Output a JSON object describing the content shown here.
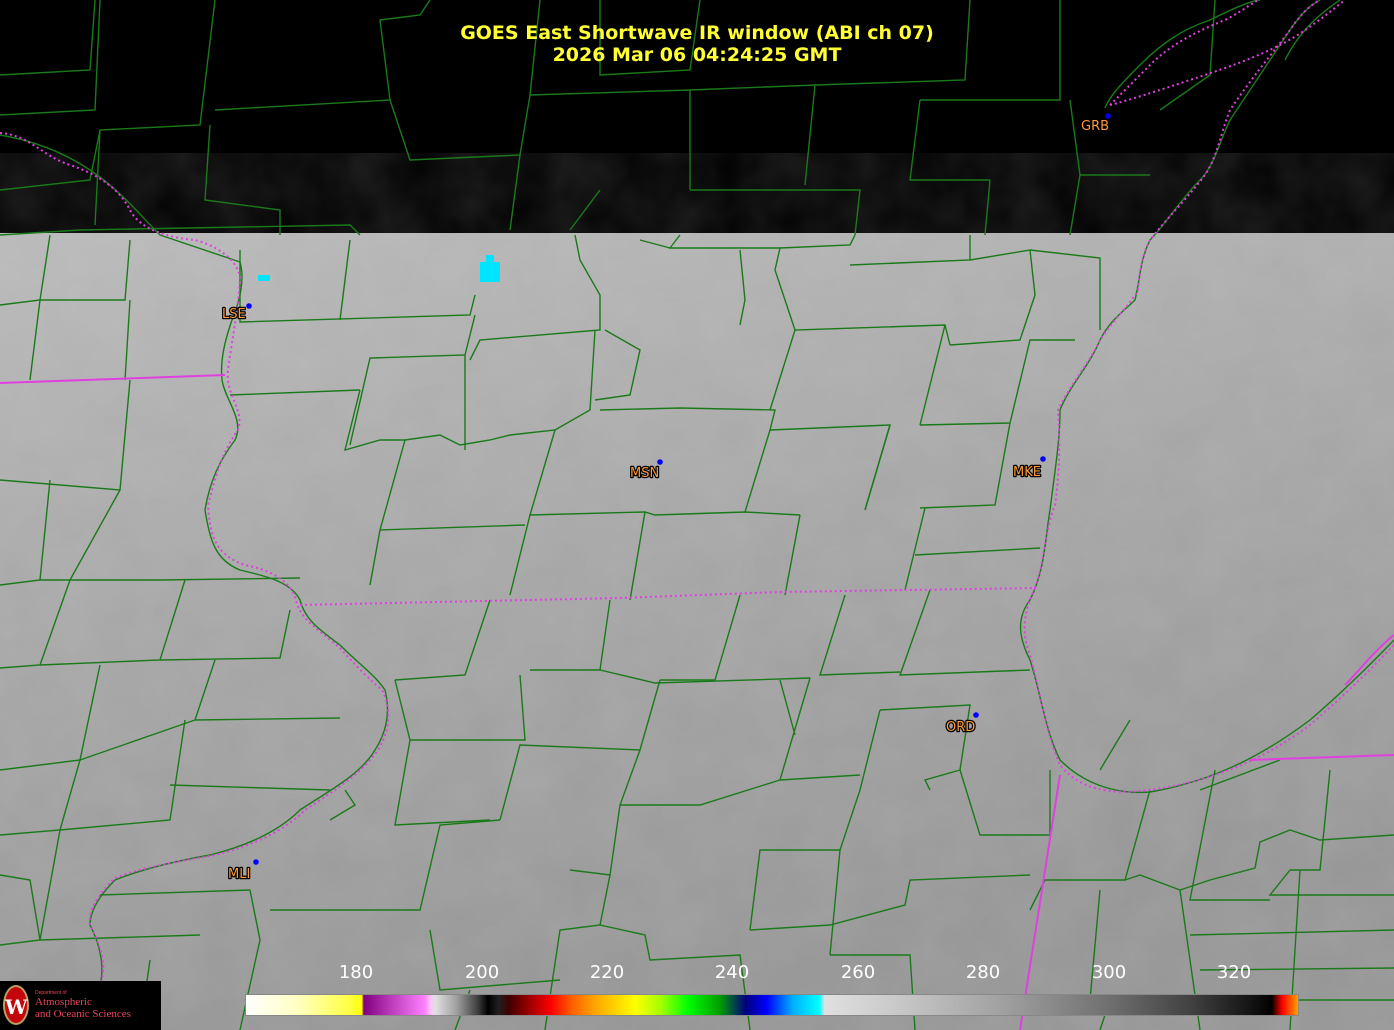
{
  "title": {
    "line1": "GOES East Shortwave IR window (ABI ch 07)",
    "line2": "2026 Mar 06  04:24:25 GMT"
  },
  "stations": [
    "GRB",
    "LSE",
    "MSN",
    "MKE",
    "ORD",
    "MLI"
  ],
  "colorbar": {
    "ticks": [
      "180",
      "200",
      "220",
      "240",
      "260",
      "280",
      "300",
      "320"
    ]
  },
  "logo": {
    "glyph": "W",
    "small_text": "Department of",
    "line1": "Atmospheric",
    "line2": "and Oceanic Sciences"
  },
  "colors": {
    "title": "#ffff33",
    "county_lines": "#1a7a1a",
    "state_lines": "#e040e0",
    "station_label": "#ff9933",
    "station_dot": "#0000ff",
    "cloud_ice": "#00e5ff"
  }
}
